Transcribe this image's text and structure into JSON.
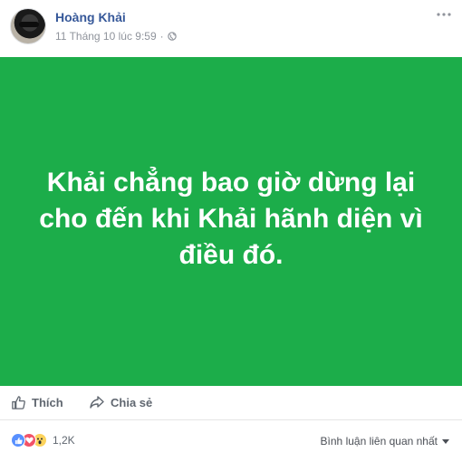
{
  "post": {
    "author": "Hoàng Khải",
    "timestamp": "11 Tháng 10 lúc 9:59",
    "separator": "·",
    "privacy_icon": "globe-icon",
    "more_icon": "more-options-icon",
    "text": "Khải chẳng bao giờ dừng lại\ncho đến khi Khải hãnh diện vì\nđiều đó.",
    "background_color": "#1cad4a"
  },
  "actions": {
    "like_label": "Thích",
    "share_label": "Chia sẻ"
  },
  "footer": {
    "reaction_icons": [
      "like-reaction-icon",
      "love-reaction-icon",
      "wow-reaction-icon"
    ],
    "reaction_count": "1,2K",
    "sort_label": "Bình luận liên quan nhất"
  },
  "colors": {
    "link_blue": "#365899",
    "meta_gray": "#90949c",
    "action_gray": "#606770"
  }
}
